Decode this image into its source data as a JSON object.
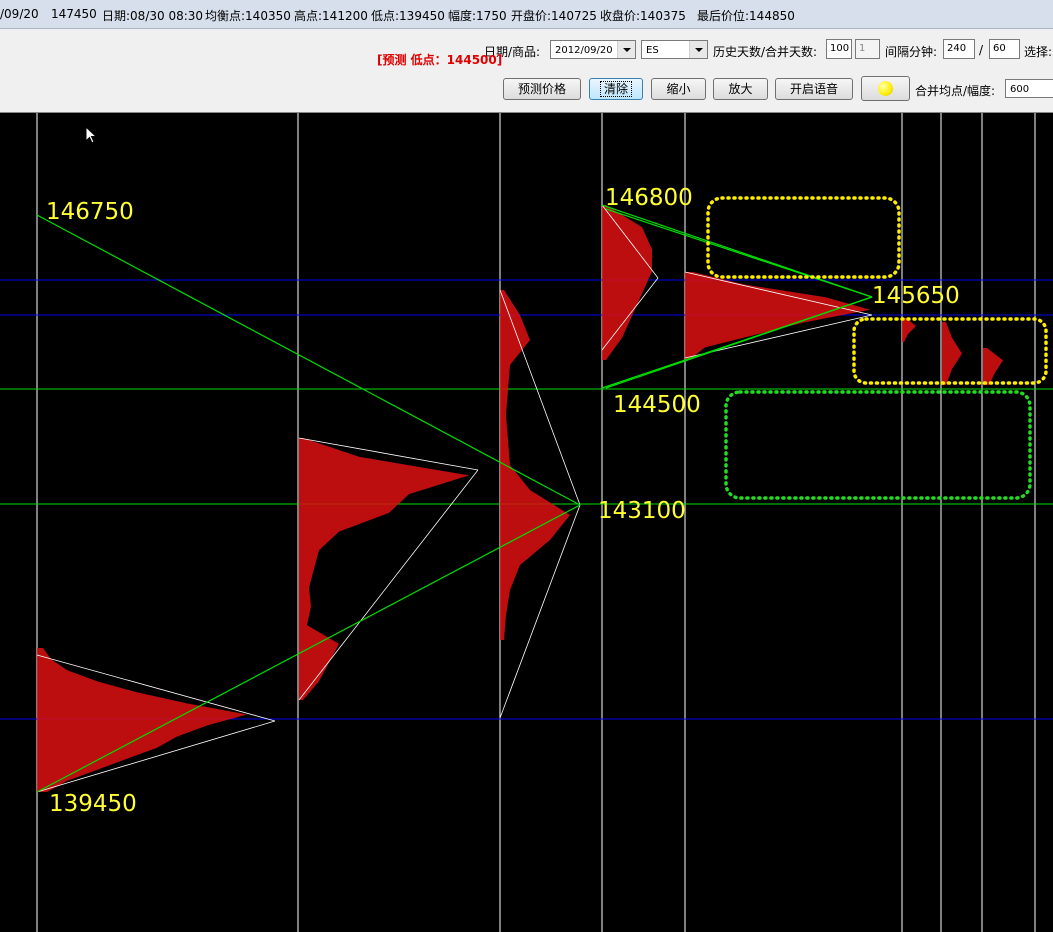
{
  "status_bar": {
    "date_fragment": "/09/20",
    "last_value": "147450",
    "date_time": "日期:08/30 08:30",
    "balance": "均衡点:140350",
    "high": "高点:141200",
    "low": "低点:139450",
    "range": "幅度:1750",
    "open": "开盘价:140725",
    "close": "收盘价:140375",
    "last_price": "最后价位:144850"
  },
  "toolbar": {
    "date_product_label": "日期/商品:",
    "date_select": "2012/09/20",
    "product_select": "ES",
    "history_days_label": "历史天数/合并天数:",
    "history_days": "100",
    "merge_days": "1",
    "interval_label": "间隔分钟:",
    "interval_a": "240",
    "slash": "/",
    "interval_b": "60",
    "select_label": "选择:",
    "prediction_text": "[预测 低点：144500]",
    "btn_predict": "预测价格",
    "btn_clear": "清除",
    "btn_zoom_out": "缩小",
    "btn_zoom_in": "放大",
    "btn_voice": "开启语音",
    "merge_label": "合并均点/幅度:",
    "merge_select": "600",
    "indicator_color": "#ffee00"
  },
  "chart_labels": {
    "l146750": "146750",
    "l146800": "146800",
    "l145650": "145650",
    "l144500": "144500",
    "l143100": "143100",
    "l139450": "139450"
  },
  "colors": {
    "background": "#000000",
    "profile": "#dd1111",
    "label": "#ffff33",
    "trend": "#00dd00",
    "level": "#0000ee",
    "separator": "#ffffff",
    "box_yellow": "#ffee00",
    "box_green": "#22dd22"
  }
}
